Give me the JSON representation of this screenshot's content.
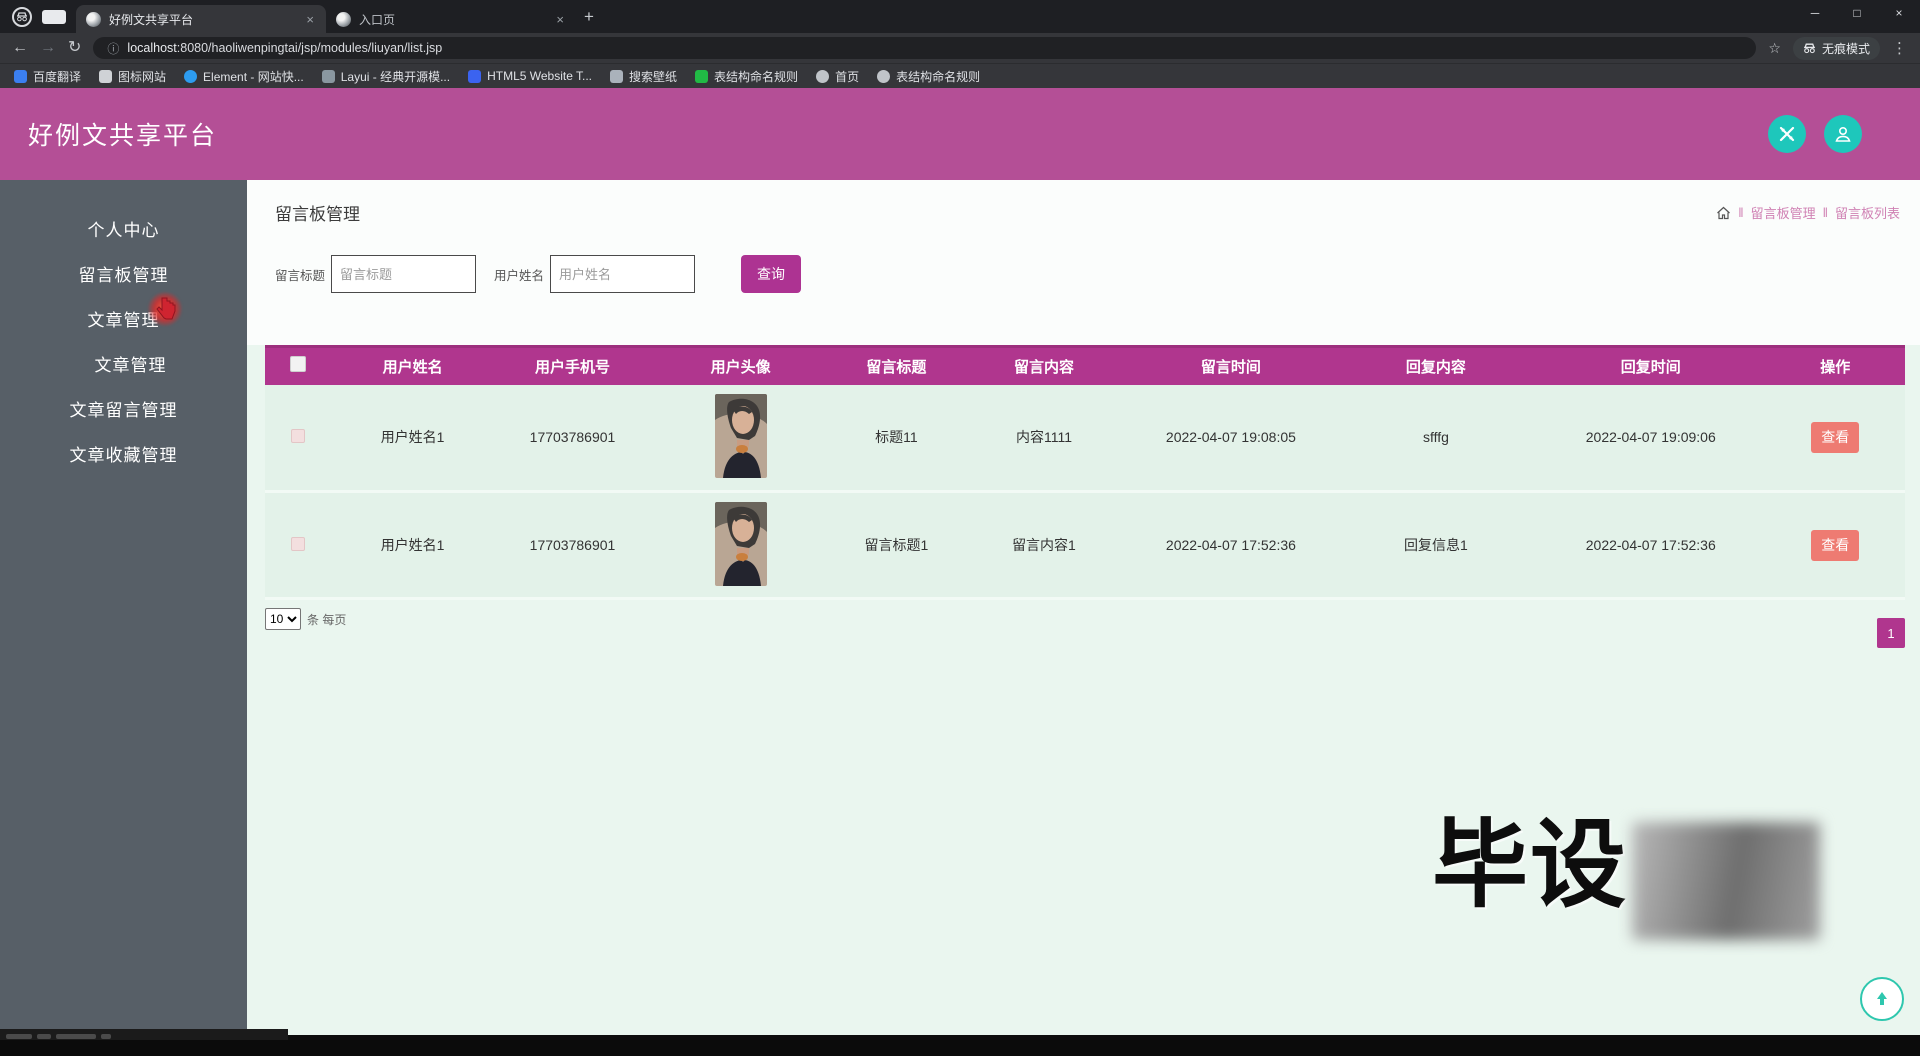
{
  "browser": {
    "tabs": [
      {
        "title": "好例文共享平台"
      },
      {
        "title": "入口页"
      }
    ],
    "url": {
      "host": "localhost",
      "path": ":8080/haoliwenpingtai/jsp/modules/liuyan/list.jsp"
    },
    "incognito_label": "无痕模式",
    "bookmarks": [
      {
        "label": "百度翻译",
        "icon_color": "#3b7ff0"
      },
      {
        "label": "图标网站",
        "icon_color": "#cfd2d6"
      },
      {
        "label": "Element - 网站快...",
        "icon_color": "#2d9cf0"
      },
      {
        "label": "Layui - 经典开源模...",
        "icon_color": "#8a97a0"
      },
      {
        "label": "HTML5 Website T...",
        "icon_color": "#3b63f0"
      },
      {
        "label": "搜索壁纸",
        "icon_color": "#aab2bb"
      },
      {
        "label": "表结构命名规则",
        "icon_color": "#21ba45"
      },
      {
        "label": "首页",
        "icon_color": "#c0c4c9"
      },
      {
        "label": "表结构命名规则",
        "icon_color": "#c0c4c9"
      }
    ]
  },
  "icons": {
    "back": "←",
    "forward": "→",
    "reload": "↻",
    "info": "ⓘ",
    "star": "☆",
    "menu": "⋮",
    "plus": "+",
    "close": "×",
    "minimize": "─",
    "restore": "□",
    "select_caret": "",
    "separator": "‖"
  },
  "header": {
    "title": "好例文共享平台"
  },
  "sidebar": {
    "items": [
      {
        "label": "个人中心"
      },
      {
        "label": "留言板管理"
      },
      {
        "label": "文章管理"
      },
      {
        "label": "文章管理"
      },
      {
        "label": "文章留言管理"
      },
      {
        "label": "文章收藏管理"
      }
    ]
  },
  "page": {
    "title": "留言板管理",
    "breadcrumb": {
      "separator": "‖",
      "items": [
        "留言板管理",
        "留言板列表"
      ]
    },
    "search": {
      "fields": [
        {
          "label": "留言标题",
          "placeholder": "留言标题"
        },
        {
          "label": "用户姓名",
          "placeholder": "用户姓名"
        }
      ],
      "submit_label": "查询"
    },
    "table": {
      "columns": [
        "用户姓名",
        "用户手机号",
        "用户头像",
        "留言标题",
        "留言内容",
        "留言时间",
        "回复内容",
        "回复时间",
        "操作"
      ],
      "rows": [
        {
          "name": "用户姓名1",
          "phone": "17703786901",
          "title": "标题11",
          "content": "内容1111",
          "time": "2022-04-07 19:08:05",
          "reply": "sfffg",
          "reply_time": "2022-04-07 19:09:06",
          "action": "查看"
        },
        {
          "name": "用户姓名1",
          "phone": "17703786901",
          "title": "留言标题1",
          "content": "留言内容1",
          "time": "2022-04-07 17:52:36",
          "reply": "回复信息1",
          "reply_time": "2022-04-07 17:52:36",
          "action": "查看"
        }
      ]
    },
    "pagination": {
      "page_size": "10",
      "per_page_label": "条 每页",
      "current_page": "1"
    }
  },
  "watermark": {
    "text": "毕设"
  },
  "colors": {
    "app_header": "#b44f96",
    "table_header": "#b0368e",
    "query_button": "#ad3392",
    "view_button": "#ee7b72",
    "teal_accent": "#1ec7bb",
    "sidebar_bg": "#575f67",
    "main_bg": "#eaf6ef",
    "breadcrumb_pink": "#d082b4"
  }
}
